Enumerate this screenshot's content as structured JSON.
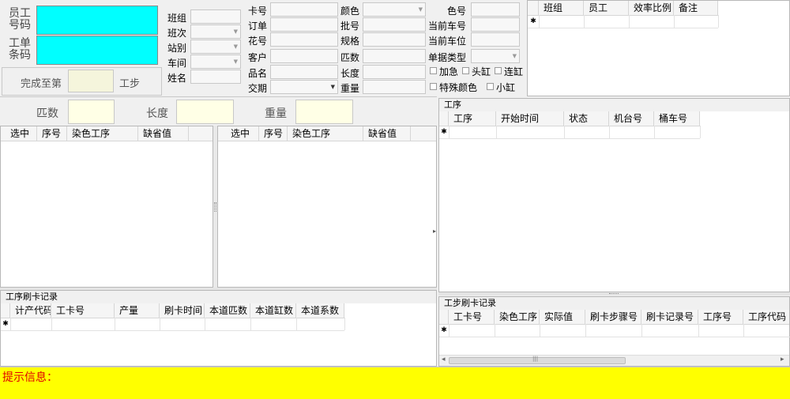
{
  "scan": {
    "emp_label": "员工\n号码",
    "job_label": "工单\n条码",
    "done_prefix": "完成至第",
    "done_suffix": "工步"
  },
  "shift": {
    "team": "班组",
    "shift": "班次",
    "station": "站别",
    "workshop": "车间",
    "name": "姓名"
  },
  "card": {
    "card_no": "卡号",
    "order": "订单",
    "pattern": "花号",
    "customer": "客户",
    "product": "品名",
    "delivery": "交期",
    "color": "颜色",
    "batch": "批号",
    "spec": "规格",
    "pieces": "匹数",
    "length": "长度",
    "weight": "重量",
    "color_no": "色号",
    "cur_car_no": "当前车号",
    "cur_car_pos": "当前车位",
    "doc_type": "单据类型",
    "urgent": "加急",
    "first_vat": "头缸",
    "cont_vat": "连缸",
    "special_color": "特殊颜色",
    "small_vat": "小缸"
  },
  "staff_grid": {
    "columns": [
      "班组",
      "员工",
      "效率比例",
      "备注"
    ]
  },
  "totals": {
    "pieces": "匹数",
    "length": "长度",
    "weight": "重量"
  },
  "left_grid": {
    "columns": [
      "选中",
      "序号",
      "染色工序",
      "缺省值"
    ]
  },
  "mid_grid": {
    "columns": [
      "选中",
      "序号",
      "染色工序",
      "缺省值"
    ]
  },
  "process": {
    "title": "工序",
    "columns": [
      "工序",
      "开始时间",
      "状态",
      "机台号",
      "桶车号"
    ]
  },
  "proc_swipe": {
    "title": "工序刷卡记录",
    "columns": [
      "计产代码",
      "工卡号",
      "产量",
      "刷卡时间",
      "本道匹数",
      "本道缸数",
      "本道系数"
    ]
  },
  "step_swipe": {
    "title": "工步刷卡记录",
    "columns": [
      "工卡号",
      "染色工序",
      "实际值",
      "刷卡步骤号",
      "刷卡记录号",
      "工序号",
      "工序代码"
    ]
  },
  "status": {
    "label": "提示信息："
  },
  "markers": {
    "new_row": "✱",
    "scroll_left": "◂",
    "scroll_right": "▸",
    "grip": "|||"
  },
  "colors": {
    "scan_fill": "#00ffff",
    "input_cream": "#ffffe6",
    "status_bar": "#ffff00",
    "status_text": "#e00000"
  }
}
